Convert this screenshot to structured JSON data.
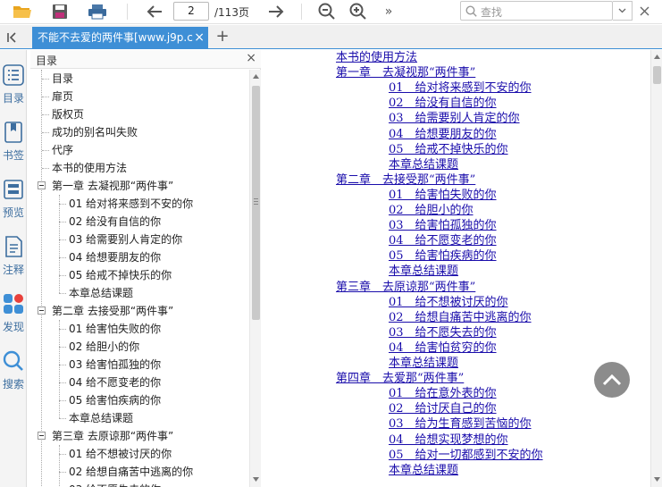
{
  "toolbar": {
    "page_current": "2",
    "page_total": "/113页",
    "search_placeholder": "查找"
  },
  "tab": {
    "title": "不能不去爱的两件事[www.j9p.c"
  },
  "rail": {
    "items": [
      {
        "label": "目录",
        "icon": "list-icon"
      },
      {
        "label": "书签",
        "icon": "bookmark-icon"
      },
      {
        "label": "预览",
        "icon": "preview-icon"
      },
      {
        "label": "注释",
        "icon": "note-icon"
      },
      {
        "label": "发现",
        "icon": "apps-icon"
      },
      {
        "label": "搜索",
        "icon": "search-icon"
      }
    ]
  },
  "toc": {
    "header": "目录",
    "items": [
      {
        "label": "目录",
        "level": 0
      },
      {
        "label": "扉页",
        "level": 0
      },
      {
        "label": "版权页",
        "level": 0
      },
      {
        "label": "成功的别名叫失败",
        "level": 0
      },
      {
        "label": "代序",
        "level": 0
      },
      {
        "label": "本书的使用方法",
        "level": 0
      },
      {
        "label": "第一章 去凝视那“两件事”",
        "level": 0,
        "expanded": true
      },
      {
        "label": "01 给对将来感到不安的你",
        "level": 1
      },
      {
        "label": "02 给没有自信的你",
        "level": 1
      },
      {
        "label": "03 给需要别人肯定的你",
        "level": 1
      },
      {
        "label": "04 给想要朋友的你",
        "level": 1
      },
      {
        "label": "05 给戒不掉快乐的你",
        "level": 1
      },
      {
        "label": "本章总结课题",
        "level": 1
      },
      {
        "label": "第二章 去接受那“两件事”",
        "level": 0,
        "expanded": true
      },
      {
        "label": "01 给害怕失败的你",
        "level": 1
      },
      {
        "label": "02 给胆小的你",
        "level": 1
      },
      {
        "label": "03 给害怕孤独的你",
        "level": 1
      },
      {
        "label": "04 给不愿变老的你",
        "level": 1
      },
      {
        "label": "05 给害怕疾病的你",
        "level": 1
      },
      {
        "label": "本章总结课题",
        "level": 1
      },
      {
        "label": "第三章 去原谅那“两件事”",
        "level": 0,
        "expanded": true
      },
      {
        "label": "01 给不想被讨厌的你",
        "level": 1
      },
      {
        "label": "02 给想自痛苦中逃离的你",
        "level": 1
      },
      {
        "label": "03 给不愿失去的你",
        "level": 1
      }
    ]
  },
  "document": {
    "lines": [
      {
        "text": "本书的使用方法",
        "indent": 0
      },
      {
        "text": "第一章　去凝视那“两件事”",
        "indent": 0
      },
      {
        "text": "01　给对将来感到不安的你",
        "indent": 1
      },
      {
        "text": "02　给没有自信的你",
        "indent": 1
      },
      {
        "text": "03　给需要别人肯定的你",
        "indent": 1
      },
      {
        "text": "04　给想要朋友的你",
        "indent": 1
      },
      {
        "text": "05　给戒不掉快乐的你",
        "indent": 1
      },
      {
        "text": "本章总结课题",
        "indent": 1
      },
      {
        "text": "第二章　去接受那“两件事”",
        "indent": 0
      },
      {
        "text": "01　给害怕失败的你",
        "indent": 1
      },
      {
        "text": "02　给胆小的你",
        "indent": 1
      },
      {
        "text": "03　给害怕孤独的你",
        "indent": 1
      },
      {
        "text": "04　给不愿变老的你",
        "indent": 1
      },
      {
        "text": "05　给害怕疾病的你",
        "indent": 1
      },
      {
        "text": "本章总结课题",
        "indent": 1
      },
      {
        "text": "第三章　去原谅那“两件事”",
        "indent": 0
      },
      {
        "text": "01　给不想被讨厌的你",
        "indent": 1
      },
      {
        "text": "02　给想自痛苦中逃离的你",
        "indent": 1
      },
      {
        "text": "03　给不愿失去的你",
        "indent": 1
      },
      {
        "text": "04　给害怕贫穷的你",
        "indent": 1
      },
      {
        "text": "本章总结课题",
        "indent": 1
      },
      {
        "text": "第四章　去爱那“两件事”",
        "indent": 0
      },
      {
        "text": "01　给在意外表的你",
        "indent": 1
      },
      {
        "text": "02　给讨厌自己的你",
        "indent": 1
      },
      {
        "text": "03　给为生育感到苦恼的你",
        "indent": 1
      },
      {
        "text": "04　给想实现梦想的你",
        "indent": 1
      },
      {
        "text": "05　给对一切都感到不安的你",
        "indent": 1
      },
      {
        "text": "本章总结课题",
        "indent": 1
      }
    ]
  },
  "colors": {
    "accent": "#3e8fd6",
    "link": "#1a0dab",
    "rail_label": "#3d6e9f"
  }
}
